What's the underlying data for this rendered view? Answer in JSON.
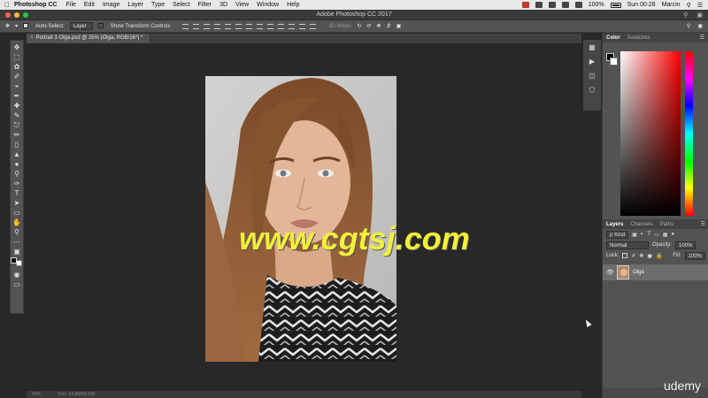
{
  "menubar": {
    "app_name": "Photoshop CC",
    "menus": [
      "File",
      "Edit",
      "Image",
      "Layer",
      "Type",
      "Select",
      "Filter",
      "3D",
      "View",
      "Window",
      "Help"
    ],
    "battery": "100%",
    "clock": "Sun 00:28",
    "user": "Marcin"
  },
  "window": {
    "title": "Adobe Photoshop CC 2017"
  },
  "options": {
    "auto_select_label": "Auto-Select:",
    "auto_select_value": "Layer",
    "show_transform_label": "Show Transform Controls",
    "mode_3d_label": "3D Mode:"
  },
  "document": {
    "tab_title": "Portrait 3 Olga.psd @ 25% (Olga, RGB/16*) *",
    "zoom": "25%",
    "doc_info": "Doc: 34.8M/69.6M"
  },
  "panels": {
    "color_tabs": [
      "Color",
      "Swatches"
    ],
    "layers_tabs": [
      "Layers",
      "Channels",
      "Paths"
    ],
    "filter_kind": "ρ Kind",
    "blend_mode": "Normal",
    "opacity_label": "Opacity:",
    "opacity_value": "100%",
    "lock_label": "Lock:",
    "fill_label": "Fill:",
    "fill_value": "100%",
    "layers": [
      {
        "name": "Olga",
        "visible": true
      }
    ]
  },
  "watermark": "www.cgtsj.com",
  "badge": "udemy",
  "colors": {
    "foreground": "#000000",
    "background": "#ffffff"
  }
}
